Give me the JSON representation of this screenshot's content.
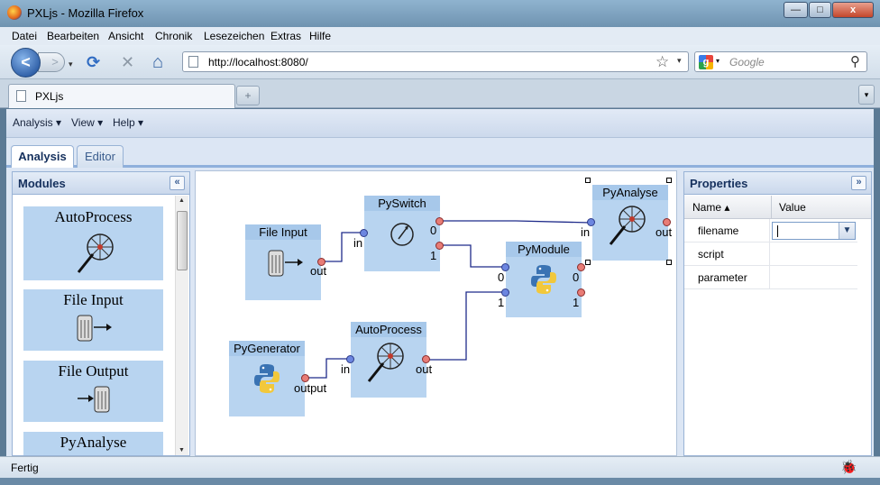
{
  "window": {
    "title": "PXLjs - Mozilla Firefox",
    "minimize": "—",
    "maximize": "□",
    "close": "x"
  },
  "menubar": {
    "items": [
      "Datei",
      "Bearbeiten",
      "Ansicht",
      "Chronik",
      "Lesezeichen",
      "Extras",
      "Hilfe"
    ]
  },
  "navbar": {
    "url": "http://localhost:8080/",
    "search_placeholder": "Google",
    "back": "<",
    "forward": ">",
    "reload": "⟳",
    "stop": "✕",
    "home": "⌂",
    "bookmark": "☆",
    "dropdown": "▾",
    "search_engine": "g",
    "search_go": "⚲"
  },
  "browser_tabs": {
    "active_tab": "PXLjs",
    "new_tab": "+",
    "tab_list": "▾"
  },
  "app_menu": {
    "items": [
      "Analysis ▾",
      "View ▾",
      "Help ▾"
    ]
  },
  "app_tabs": {
    "analysis": "Analysis",
    "editor": "Editor"
  },
  "modules_panel": {
    "title": "Modules",
    "collapse": "«",
    "items": [
      "AutoProcess",
      "File Input",
      "File Output",
      "PyAnalyse"
    ]
  },
  "canvas": {
    "nodes": {
      "file_input": {
        "title": "File Input",
        "out_label": "out"
      },
      "pyswitch": {
        "title": "PySwitch",
        "in_label": "in",
        "out0_label": "0",
        "out1_label": "1"
      },
      "pyanalyse": {
        "title": "PyAnalyse",
        "in_label": "in",
        "out_label": "out"
      },
      "pymodule": {
        "title": "PyModule",
        "in0_label": "0",
        "in1_label": "1",
        "out0_label": "0",
        "out1_label": "1"
      },
      "pygenerator": {
        "title": "PyGenerator",
        "out_label": "output"
      },
      "autoprocess": {
        "title": "AutoProcess",
        "in_label": "in",
        "out_label": "out"
      }
    }
  },
  "properties_panel": {
    "title": "Properties",
    "collapse": "»",
    "columns": {
      "name": "Name ▴",
      "value": "Value"
    },
    "rows": [
      {
        "name": "filename",
        "value": ""
      },
      {
        "name": "script",
        "value": ""
      },
      {
        "name": "parameter",
        "value": ""
      }
    ]
  },
  "status": {
    "text": "Fertig"
  },
  "colors": {
    "node_bg": "#b8d4f0",
    "node_header": "#a7c8ea",
    "in_port": "#6c86e0",
    "out_port": "#e87c76",
    "wire": "#1f2b8a"
  }
}
